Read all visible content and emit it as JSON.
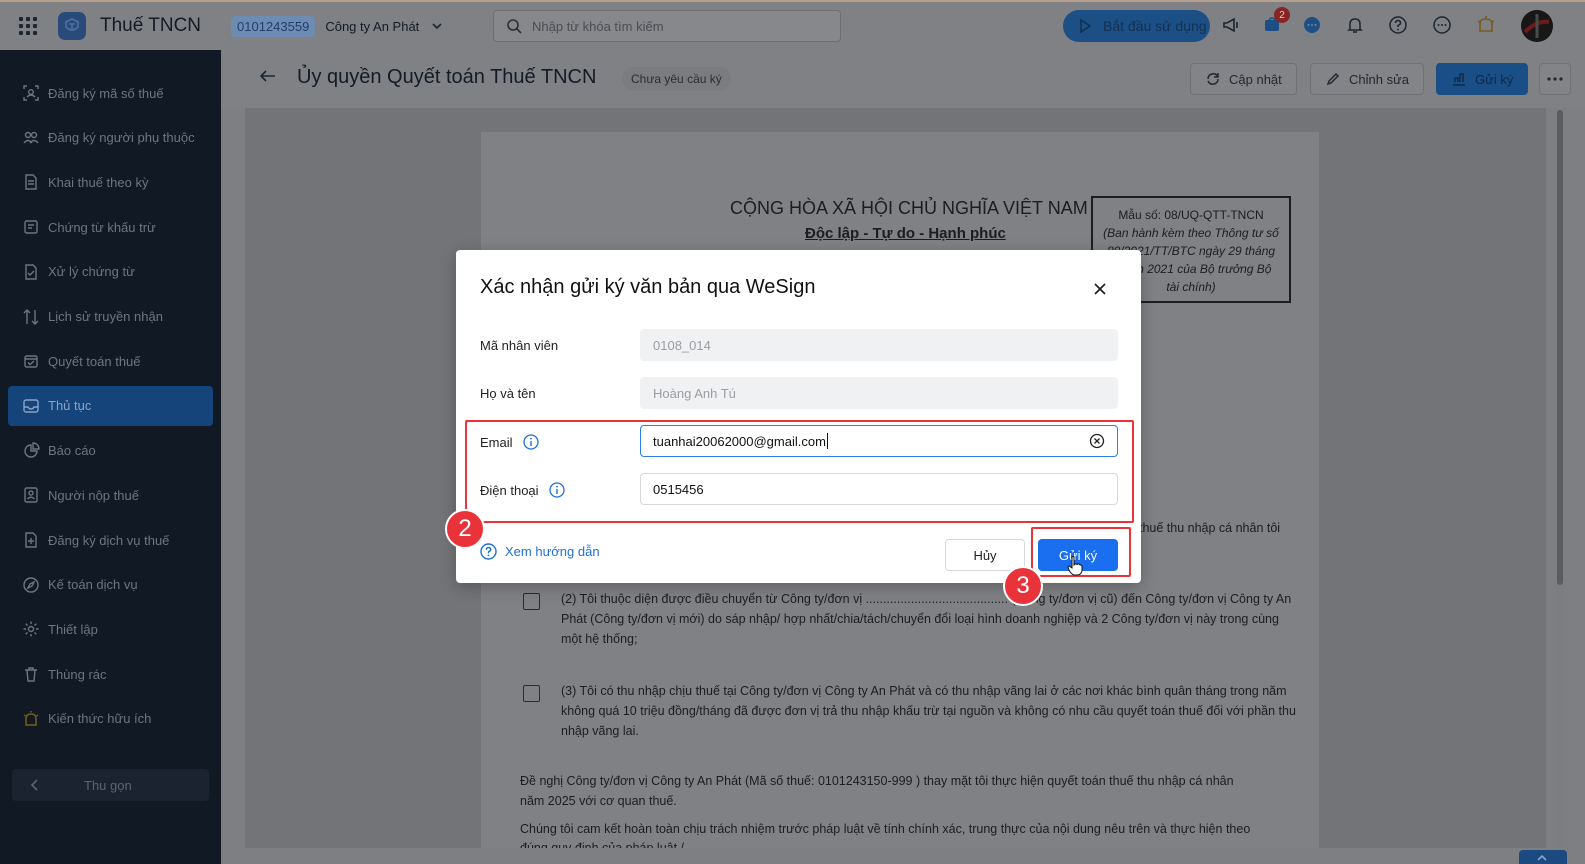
{
  "topbar": {
    "app_title": "Thuế TNCN",
    "tax_code": "0101243559",
    "company": "Công ty An Phát",
    "search_placeholder": "Nhập từ khóa tìm kiếm",
    "start_button": "Bắt đầu sử dụng",
    "cart_badge": "2"
  },
  "sidebar": {
    "items": [
      {
        "label": "Đăng ký mã số thuế",
        "icon": "id-scan-icon"
      },
      {
        "label": "Đăng ký người phụ thuộc",
        "icon": "users-icon"
      },
      {
        "label": "Khai thuế theo kỳ",
        "icon": "document-icon"
      },
      {
        "label": "Chứng từ khấu trừ",
        "icon": "receipt-icon"
      },
      {
        "label": "Xử lý chứng từ",
        "icon": "document-check-icon"
      },
      {
        "label": "Lịch sử truyền nhận",
        "icon": "transfer-icon"
      },
      {
        "label": "Quyết toán thuế",
        "icon": "calendar-check-icon"
      },
      {
        "label": "Thủ tục",
        "icon": "inbox-icon",
        "active": true
      },
      {
        "label": "Báo cáo",
        "icon": "pie-chart-icon"
      },
      {
        "label": "Người nộp thuế",
        "icon": "person-card-icon"
      },
      {
        "label": "Đăng ký dịch vụ thuế",
        "icon": "register-icon"
      },
      {
        "label": "Kế toán dịch vụ",
        "icon": "compass-icon"
      },
      {
        "label": "Thiết lập",
        "icon": "gear-icon"
      },
      {
        "label": "Thùng rác",
        "icon": "trash-icon"
      },
      {
        "label": "Kiến thức hữu ích",
        "icon": "lightbulb-icon"
      }
    ],
    "collapse_label": "Thu gọn"
  },
  "page": {
    "title": "Ủy quyền Quyết toán Thuế TNCN",
    "status": "Chưa yêu cầu ký",
    "update_button": "Cập nhật",
    "edit_button": "Chỉnh sửa",
    "send_sign_button": "Gửi ký"
  },
  "document": {
    "heading": "CỘNG HÒA XÃ HỘI CHỦ NGHĨA VIỆT NAM",
    "motto": "Độc lập - Tự do - Hạnh phúc",
    "form_code": "Mẫu số: 08/UQ-QTT-TNCN",
    "form_note": "(Ban hành kèm theo Thông tư số 80/2021/TT/BTC ngày 29 tháng 9 năm 2021 của Bộ trưởng Bộ tài chính)",
    "partial_line": "thuế thu nhập cá nhân tôi",
    "item2": "(2) Tôi thuộc diện được điều chuyển từ Công ty/đơn vị ......................................... (Công ty/đơn vị cũ) đến Công ty/đơn vị Công ty An Phát (Công ty/đơn vị mới) do sáp nhập/ hợp nhất/chia/tách/chuyển đổi loại hình doanh nghiệp và 2 Công ty/đơn vị này trong cùng một hệ thống;",
    "item3": "(3) Tôi có thu nhập chịu thuế tại Công ty/đơn vị Công ty An Phát và có thu nhập vãng lai ở các nơi khác bình quân tháng trong năm không quá 10 triệu đồng/tháng đã được đơn vị trả thu nhập khấu trừ tại nguồn và không có nhu cầu quyết toán thuế đối với phần thu nhập vãng lai.",
    "request_line1": "Đề nghị Công ty/đơn vị  Công ty An Phát  (Mã số thuế:  0101243150-999 ) thay mặt tôi thực hiện quyết toán thuế thu nhập cá nhân",
    "request_line2": "năm  2025  với cơ quan thuế.",
    "commit_line1": "Chúng tôi cam kết hoàn toàn chịu trách nhiệm trước pháp luật về tính chính xác, trung thực của nội dung nêu trên và thực hiện theo",
    "commit_line2": "đúng quy định của pháp luật./."
  },
  "modal": {
    "title": "Xác nhận gửi ký văn bản qua WeSign",
    "employee_code_label": "Mã nhân viên",
    "employee_code_value": "0108_014",
    "full_name_label": "Họ và tên",
    "full_name_value": "Hoàng Anh Tú",
    "email_label": "Email",
    "email_value": "tuanhai20062000@gmail.com",
    "phone_label": "Điện thoại",
    "phone_value": "0515456",
    "guide_link": "Xem hướng dẫn",
    "cancel_button": "Hủy",
    "send_button": "Gửi ký"
  },
  "annotations": {
    "step_email_phone": "2",
    "step_send": "3"
  },
  "colors": {
    "sidebar_bg": "#111925",
    "active_item": "#14447a",
    "primary": "#1a6ff0",
    "highlight": "#e8333a"
  }
}
